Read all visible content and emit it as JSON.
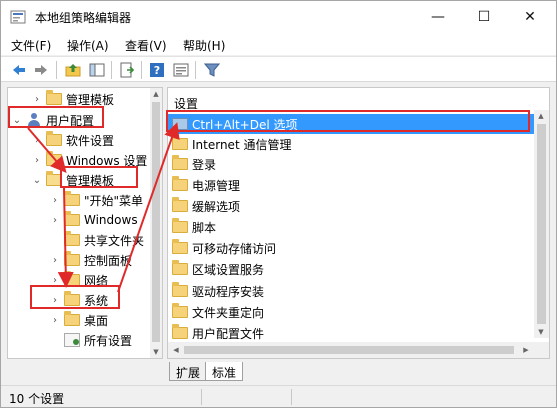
{
  "window": {
    "title": "本地组策略编辑器",
    "minimize_glyph": "—",
    "maximize_glyph": "☐",
    "close_glyph": "✕"
  },
  "menu": [
    "文件(F)",
    "操作(A)",
    "查看(V)",
    "帮助(H)"
  ],
  "toolbar": {
    "icons": [
      "back-arrow-icon",
      "forward-arrow-icon",
      "up-folder-icon",
      "show-hide-tree-icon",
      "export-list-icon",
      "help-icon",
      "properties-icon",
      "filter-icon"
    ]
  },
  "tree": {
    "items": [
      {
        "label": "管理模板",
        "indent": 1,
        "chevron": "›",
        "icon": "folder"
      },
      {
        "label": "用户配置",
        "indent": 0,
        "chevron": "⌄",
        "icon": "user"
      },
      {
        "label": "软件设置",
        "indent": 1,
        "chevron": "›",
        "icon": "folder"
      },
      {
        "label": "Windows 设置",
        "indent": 1,
        "chevron": "›",
        "icon": "folder"
      },
      {
        "label": "管理模板",
        "indent": 1,
        "chevron": "⌄",
        "icon": "folder-open"
      },
      {
        "label": "\"开始\"菜单",
        "indent": 2,
        "chevron": "›",
        "icon": "folder"
      },
      {
        "label": "Windows",
        "indent": 2,
        "chevron": "›",
        "icon": "folder"
      },
      {
        "label": "共享文件夹",
        "indent": 2,
        "chevron": "",
        "icon": "folder"
      },
      {
        "label": "控制面板",
        "indent": 2,
        "chevron": "›",
        "icon": "folder"
      },
      {
        "label": "网络",
        "indent": 2,
        "chevron": "›",
        "icon": "folder"
      },
      {
        "label": "系统",
        "indent": 2,
        "chevron": "›",
        "icon": "folder"
      },
      {
        "label": "桌面",
        "indent": 2,
        "chevron": "›",
        "icon": "folder"
      },
      {
        "label": "所有设置",
        "indent": 2,
        "chevron": "",
        "icon": "settings"
      }
    ]
  },
  "list": {
    "header": "设置",
    "rows": [
      {
        "label": "Ctrl+Alt+Del 选项",
        "selected": true
      },
      {
        "label": "Internet 通信管理",
        "selected": false
      },
      {
        "label": "登录",
        "selected": false
      },
      {
        "label": "电源管理",
        "selected": false
      },
      {
        "label": "缓解选项",
        "selected": false
      },
      {
        "label": "脚本",
        "selected": false
      },
      {
        "label": "可移动存储访问",
        "selected": false
      },
      {
        "label": "区域设置服务",
        "selected": false
      },
      {
        "label": "驱动程序安装",
        "selected": false
      },
      {
        "label": "文件夹重定向",
        "selected": false
      },
      {
        "label": "用户配置文件",
        "selected": false
      }
    ]
  },
  "tabs": [
    "扩展",
    "标准"
  ],
  "status": {
    "text": "10 个设置"
  },
  "annotation_color": "#e02a2a"
}
